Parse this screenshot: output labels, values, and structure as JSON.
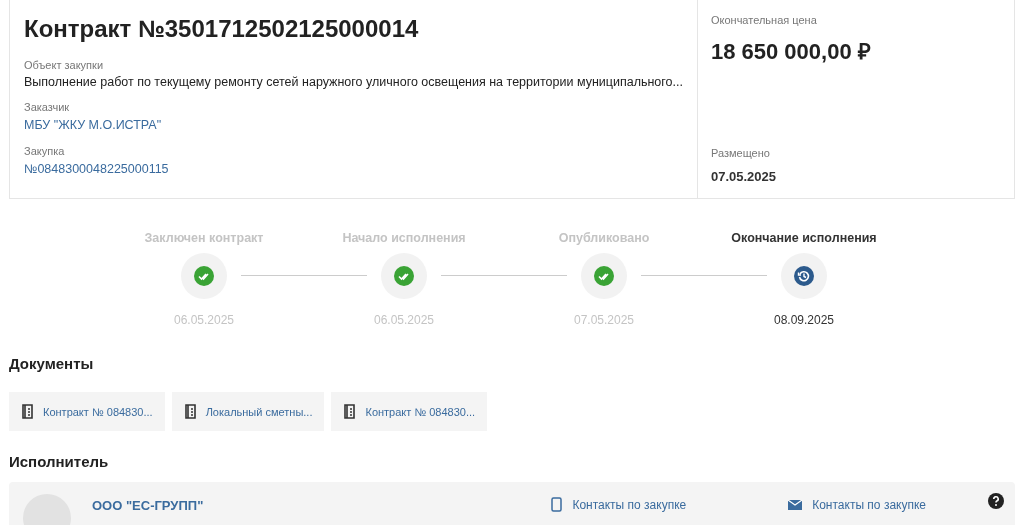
{
  "contract": {
    "title": "Контракт №3501712502125000014",
    "fields": [
      {
        "label": "Объект закупки",
        "value": "Выполнение работ по текущему ремонту сетей наружного уличного освещения на территории муниципального...",
        "kind": "text"
      },
      {
        "label": "Заказчик",
        "value": "МБУ \"ЖКУ М.О.ИСТРА\"",
        "kind": "link"
      },
      {
        "label": "Закупка",
        "value": "№0848300048225000115",
        "kind": "link"
      }
    ],
    "price_label": "Окончательная цена",
    "price": "18 650 000,00 ₽",
    "posted_label": "Размещено",
    "posted": "07.05.2025"
  },
  "stages": [
    {
      "label": "Заключен контракт",
      "date": "06.05.2025",
      "completed": true
    },
    {
      "label": "Начало исполнения",
      "date": "06.05.2025",
      "completed": true
    },
    {
      "label": "Опубликовано",
      "date": "07.05.2025",
      "completed": true
    },
    {
      "label": "Окончание исполнения",
      "date": "08.09.2025",
      "completed": false
    }
  ],
  "documents": {
    "title": "Документы",
    "items": [
      "Контракт № 084830...",
      "Локальный сметны...",
      "Контракт № 084830..."
    ]
  },
  "executor": {
    "title": "Исполнитель",
    "name": "ООО \"ЕС-ГРУПП\"",
    "phone_contacts": "Контакты по закупке",
    "email_contacts": "Контакты по закупке"
  }
}
